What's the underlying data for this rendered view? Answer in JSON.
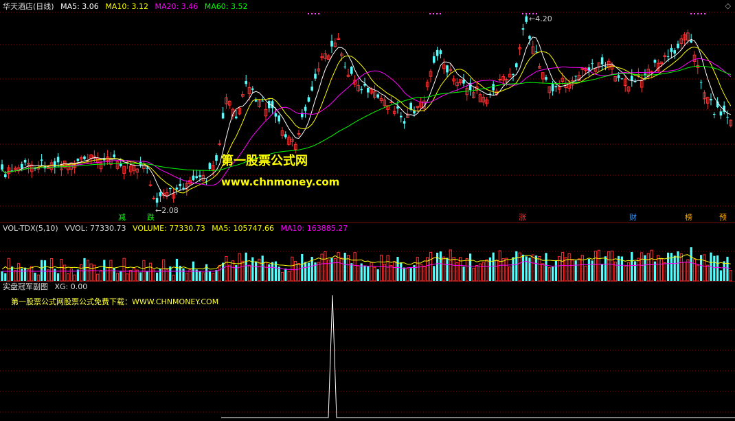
{
  "main": {
    "title": "华天酒店(日线)",
    "ma5": "MA5: 3.06",
    "ma10": "MA10: 3.12",
    "ma20": "MA20: 3.46",
    "ma60": "MA60: 3.52",
    "high_label": "4.20",
    "low_label": "2.08",
    "markers": [
      "减",
      "跌",
      "涨",
      "财",
      "榜",
      "预"
    ]
  },
  "volume": {
    "title": "VOL-TDX(5,10)",
    "vvol": "VVOL: 77330.73",
    "volume": "VOLUME: 77330.73",
    "ma5": "MA5: 105747.66",
    "ma10": "MA10: 163885.27"
  },
  "indicator": {
    "title": "实盘冠军副图",
    "xg": "XG: 0.00",
    "text": "第一股票公式网股票公式免费下载：WWW.CHNMONEY.COM"
  },
  "watermark": {
    "line1": "第一股票公式网",
    "line2": "www.chnmoney.com"
  },
  "colors": {
    "up": "#ff3232",
    "down": "#54ffff",
    "ma5": "#ffffff",
    "ma10": "#ffff00",
    "ma20": "#ff00ff",
    "ma60": "#00ff00",
    "grid": "#7a1010"
  },
  "chart_data": [
    {
      "type": "candlestick",
      "title": "华天酒店(日线)",
      "series": [
        {
          "name": "MA5",
          "values": [
            3.06
          ]
        },
        {
          "name": "MA10",
          "values": [
            3.12
          ]
        },
        {
          "name": "MA20",
          "values": [
            3.46
          ]
        },
        {
          "name": "MA60",
          "values": [
            3.52
          ]
        }
      ],
      "ylim": [
        2.0,
        4.3
      ],
      "annotations": [
        {
          "text": "4.20",
          "value": 4.2
        },
        {
          "text": "2.08",
          "value": 2.08
        }
      ]
    },
    {
      "type": "bar",
      "title": "VOL-TDX(5,10)",
      "series": [
        {
          "name": "VOLUME",
          "values": [
            77330.73
          ]
        },
        {
          "name": "MA5",
          "values": [
            105747.66
          ]
        },
        {
          "name": "MA10",
          "values": [
            163885.27
          ]
        }
      ]
    },
    {
      "type": "line",
      "title": "实盘冠军副图",
      "series": [
        {
          "name": "XG",
          "values": [
            0.0
          ]
        }
      ]
    }
  ]
}
